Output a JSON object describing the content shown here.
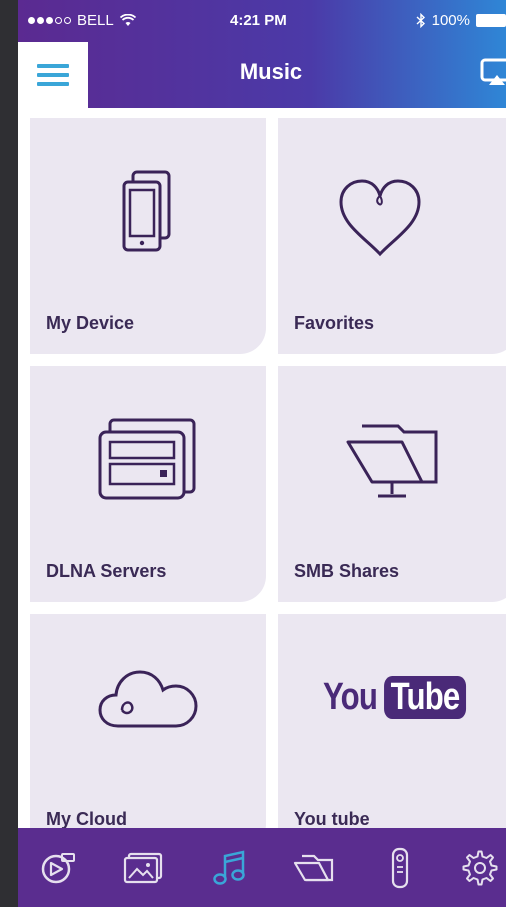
{
  "status_bar": {
    "carrier": "BELL",
    "time": "4:21 PM",
    "battery": "100%"
  },
  "nav": {
    "title": "Music",
    "menu_icon": "hamburger-menu-icon",
    "airplay_icon": "airplay-icon"
  },
  "tiles": [
    {
      "label": "My Device",
      "icon": "phone-icon"
    },
    {
      "label": "Favorites",
      "icon": "heart-icon"
    },
    {
      "label": "DLNA Servers",
      "icon": "server-icon"
    },
    {
      "label": "SMB Shares",
      "icon": "network-folder-icon"
    },
    {
      "label": "My Cloud",
      "icon": "cloud-icon"
    },
    {
      "label": "You tube",
      "icon": "youtube-logo"
    }
  ],
  "youtube_logo": {
    "you": "You",
    "tube": "Tube"
  },
  "tab_bar": {
    "items": [
      {
        "icon": "video-disc-icon",
        "active": false
      },
      {
        "icon": "photos-icon",
        "active": false
      },
      {
        "icon": "music-note-icon",
        "active": true
      },
      {
        "icon": "folder-icon",
        "active": false
      },
      {
        "icon": "remote-icon",
        "active": false
      },
      {
        "icon": "settings-gear-icon",
        "active": false
      }
    ]
  },
  "colors": {
    "accent_purple": "#5a2d8f",
    "tile_bg": "#ebe7f1",
    "active_tab": "#3aa6d8"
  }
}
